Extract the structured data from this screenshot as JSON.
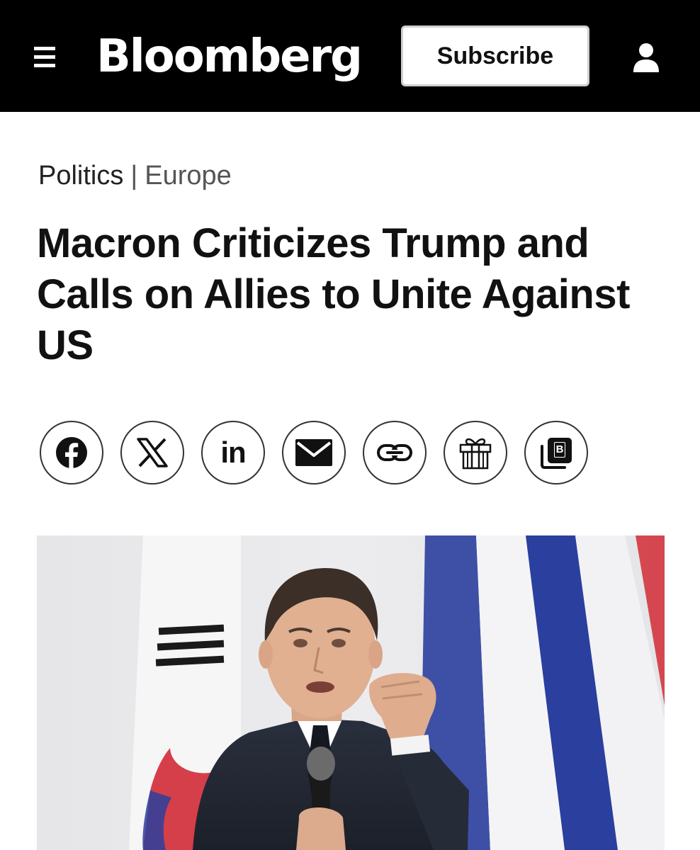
{
  "header": {
    "logo_text": "Bloomberg",
    "subscribe_label": "Subscribe",
    "menu_icon": "hamburger-menu-icon",
    "account_icon": "user-icon",
    "background_color": "#000000"
  },
  "breadcrumb": {
    "primary": "Politics",
    "separator": "|",
    "secondary": "Europe"
  },
  "article": {
    "headline": "Macron Criticizes Trump and Calls on Allies to Unite Against US"
  },
  "share": {
    "buttons": [
      {
        "icon": "facebook-icon"
      },
      {
        "icon": "x-icon"
      },
      {
        "icon": "linkedin-icon",
        "label": "in"
      },
      {
        "icon": "email-icon"
      },
      {
        "icon": "link-icon"
      },
      {
        "icon": "gift-icon"
      },
      {
        "icon": "bloomberg-app-icon",
        "label": "B"
      }
    ]
  },
  "hero_image": {
    "flag_colors": {
      "blue": "#2b3f9e",
      "red": "#d22b35",
      "black": "#1a1a1a"
    }
  }
}
